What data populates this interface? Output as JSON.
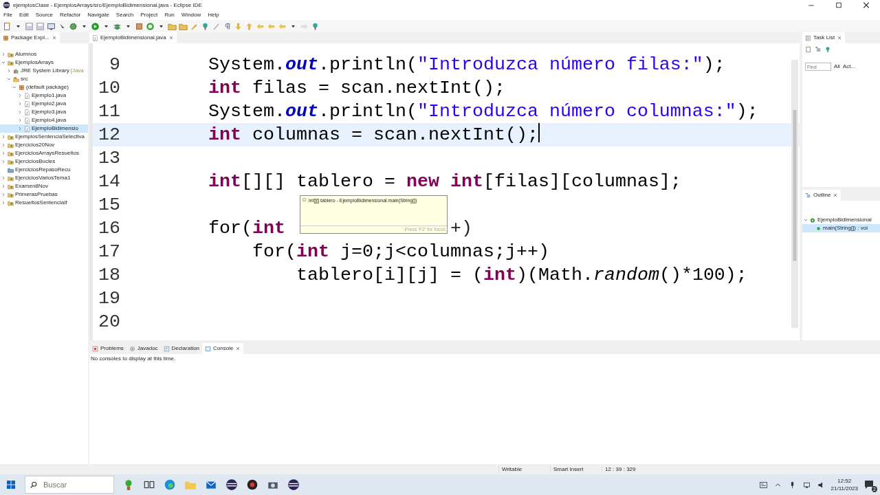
{
  "window": {
    "title": "ejemplosClase - EjemplosArrays/src/EjemploBidimensional.java - Eclipse IDE"
  },
  "menu": [
    "File",
    "Edit",
    "Source",
    "Refactor",
    "Navigate",
    "Search",
    "Project",
    "Run",
    "Window",
    "Help"
  ],
  "package_explorer": {
    "tab": "Package Expl...",
    "tree": [
      {
        "label": "Alumnos",
        "kind": "project",
        "expanded": false,
        "selected": false
      },
      {
        "label": "EjemplosArrays",
        "kind": "project",
        "expanded": true,
        "selected": false,
        "children": [
          {
            "label": "JRE System Library",
            "decoration": "[Java",
            "kind": "library",
            "expanded": false,
            "selected": false
          },
          {
            "label": "src",
            "kind": "source-folder",
            "expanded": true,
            "selected": false,
            "children": [
              {
                "label": "(default package)",
                "kind": "package",
                "expanded": true,
                "selected": false,
                "children": [
                  {
                    "label": "Ejemplo1.java",
                    "kind": "file",
                    "expanded": false,
                    "selected": false
                  },
                  {
                    "label": "Ejemplo2.java",
                    "kind": "file",
                    "expanded": false,
                    "selected": false
                  },
                  {
                    "label": "Ejemplo3.java",
                    "kind": "file",
                    "expanded": false,
                    "selected": false
                  },
                  {
                    "label": "Ejemplo4.java",
                    "kind": "file",
                    "expanded": false,
                    "selected": false
                  },
                  {
                    "label": "EjemploBidimensio",
                    "kind": "file",
                    "expanded": false,
                    "selected": true
                  }
                ]
              }
            ]
          }
        ]
      },
      {
        "label": "EjemplosSentenciaSelectiva",
        "kind": "project",
        "expanded": false,
        "selected": false
      },
      {
        "label": "Ejercicios20Nov",
        "kind": "project",
        "expanded": false,
        "selected": false
      },
      {
        "label": "EjerciciosArraysResueltos",
        "kind": "project",
        "expanded": false,
        "selected": false
      },
      {
        "label": "EjerciciosBucles",
        "kind": "project",
        "expanded": false,
        "selected": false
      },
      {
        "label": "EjerciciosRepasoRecu",
        "kind": "closed-project",
        "selected": false
      },
      {
        "label": "EjerciciosVariosTema1",
        "kind": "project",
        "expanded": false,
        "selected": false
      },
      {
        "label": "Examen8Nov",
        "kind": "project",
        "expanded": false,
        "selected": false
      },
      {
        "label": "PrimerasPruebas",
        "kind": "project",
        "expanded": false,
        "selected": false
      },
      {
        "label": "ResueltosSentenciaIf",
        "kind": "project",
        "expanded": false,
        "selected": false
      }
    ]
  },
  "editor": {
    "tab": "EjemploBidimensional.java",
    "lines": [
      {
        "number": "9",
        "current": false,
        "tokens": [
          {
            "text": "System.",
            "kind": "plain"
          },
          {
            "text": "out",
            "kind": "static-field"
          },
          {
            "text": ".println(",
            "kind": "plain"
          },
          {
            "text": "\"Introduzca número filas:\"",
            "kind": "string"
          },
          {
            "text": ");",
            "kind": "plain"
          }
        ]
      },
      {
        "number": "10",
        "current": false,
        "tokens": [
          {
            "text": "int",
            "kind": "keyword"
          },
          {
            "text": " filas = scan.nextInt();",
            "kind": "plain"
          }
        ]
      },
      {
        "number": "11",
        "current": false,
        "tokens": [
          {
            "text": "System.",
            "kind": "plain"
          },
          {
            "text": "out",
            "kind": "static-field"
          },
          {
            "text": ".println(",
            "kind": "plain"
          },
          {
            "text": "\"Introduzca número columnas:\"",
            "kind": "string"
          },
          {
            "text": ");",
            "kind": "plain"
          }
        ]
      },
      {
        "number": "12",
        "current": true,
        "tokens": [
          {
            "text": "int",
            "kind": "keyword"
          },
          {
            "text": " columnas = scan.nextInt();",
            "kind": "plain"
          }
        ]
      },
      {
        "number": "13",
        "current": false
      },
      {
        "number": "14",
        "current": false,
        "tokens": [
          {
            "text": "int",
            "kind": "keyword"
          },
          {
            "text": "[][] tablero = ",
            "kind": "plain"
          },
          {
            "text": "new",
            "kind": "keyword"
          },
          {
            "text": " int",
            "kind": "keyword"
          },
          {
            "text": "[filas][columnas];",
            "kind": "plain"
          }
        ]
      },
      {
        "number": "15",
        "current": false
      },
      {
        "number": "16",
        "current": false,
        "tokens": [
          {
            "text": "for(",
            "kind": "plain"
          },
          {
            "text": "int",
            "kind": "keyword"
          }
        ],
        "tail": "+)"
      },
      {
        "number": "17",
        "current": false,
        "tokens": [
          {
            "text": "    for(",
            "kind": "plain"
          },
          {
            "text": "int",
            "kind": "keyword"
          },
          {
            "text": " j=0;j<columnas;j++)",
            "kind": "plain"
          }
        ]
      },
      {
        "number": "18",
        "current": false,
        "tokens": [
          {
            "text": "        tablero[i][j] = (",
            "kind": "plain"
          },
          {
            "text": "int",
            "kind": "keyword"
          },
          {
            "text": ")(Math.",
            "kind": "plain"
          },
          {
            "text": "random",
            "kind": "static-method"
          },
          {
            "text": "()*100);",
            "kind": "plain"
          }
        ]
      },
      {
        "number": "19",
        "current": false
      },
      {
        "number": "20",
        "current": false
      }
    ],
    "tooltip": {
      "text": "int[][] tablero - EjemploBidimensional.main(String[])",
      "hint": "Press 'F2' for focus"
    }
  },
  "task_list": {
    "tab": "Task List",
    "find": {
      "placeholder": "Find"
    },
    "filters": [
      "All",
      "Act..."
    ]
  },
  "outline": {
    "tab": "Outline",
    "tree": [
      {
        "label": "EjemploBidimensional",
        "kind": "class",
        "expanded": true,
        "selected": false,
        "children": [
          {
            "label": "main(String[]) : voi",
            "kind": "method",
            "selected": true
          }
        ]
      }
    ]
  },
  "bottom_panel": {
    "tabs": [
      {
        "label": "Problems",
        "selected": false
      },
      {
        "label": "Javadoc",
        "selected": false
      },
      {
        "label": "Declaration",
        "selected": false
      },
      {
        "label": "Console",
        "selected": true
      }
    ],
    "message": "No consoles to display at this time."
  },
  "status_bar": [
    "Writable",
    "Smart Insert",
    "12 : 39 : 329"
  ],
  "taskbar": {
    "search": {
      "placeholder": "Buscar"
    },
    "time": "12:52",
    "date": "21/11/2023",
    "notifications": "2"
  }
}
